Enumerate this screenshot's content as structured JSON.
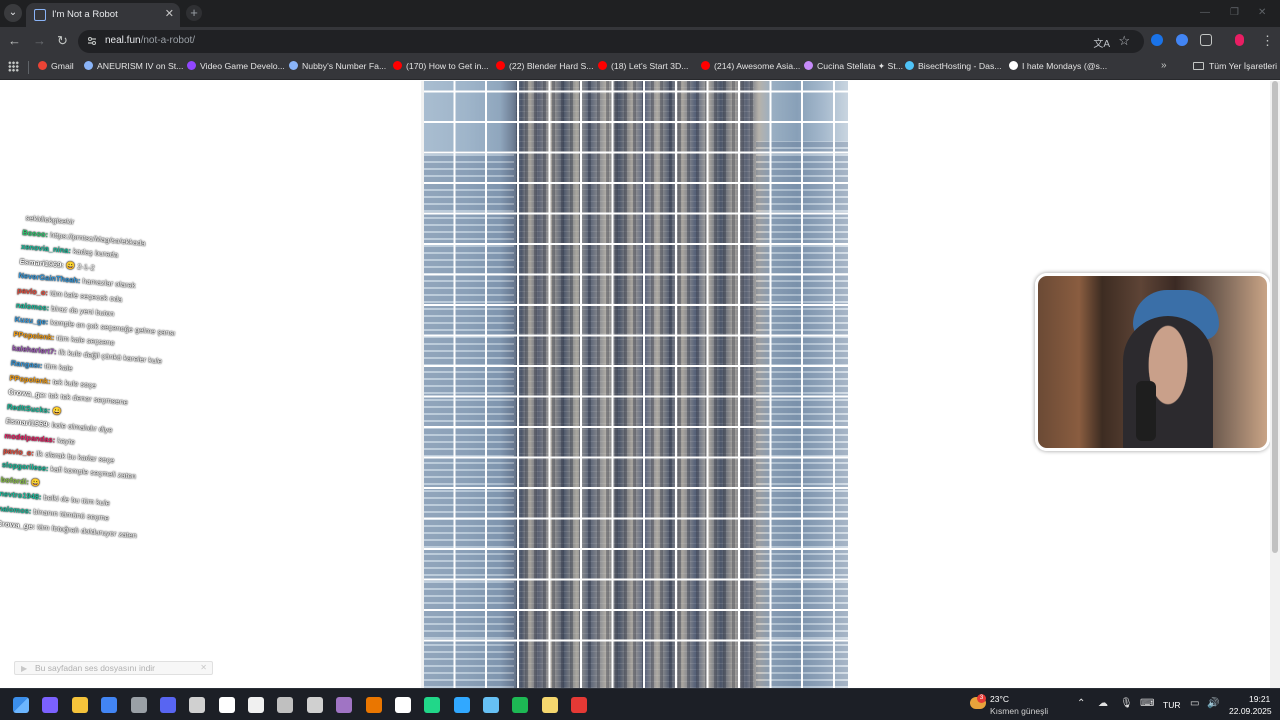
{
  "browser": {
    "tab_title": "I'm Not a Robot",
    "url_host": "neal.fun",
    "url_path": "/not-a-robot/",
    "all_bookmarks_label": "Tüm Yer İşaretleri"
  },
  "bookmarks": [
    {
      "label": "Gmail",
      "color": "#ea4335"
    },
    {
      "label": "ANEURISM IV on St...",
      "color": "#8ab4f8"
    },
    {
      "label": "Video Game Develo...",
      "color": "#9146ff"
    },
    {
      "label": "Nubby's Number Fa...",
      "color": "#8ab4f8"
    },
    {
      "label": "(170) How to Get in...",
      "color": "#ff0000"
    },
    {
      "label": "(22) Blender Hard S...",
      "color": "#ff0000"
    },
    {
      "label": "(18) Let's Start 3D...",
      "color": "#ff0000"
    },
    {
      "label": "(214) Awesome Asia...",
      "color": "#ff0000"
    },
    {
      "label": "Cucina Stellata ✦ St...",
      "color": "#c58af9"
    },
    {
      "label": "BisectHosting - Das...",
      "color": "#4fc3f7"
    },
    {
      "label": "I hate Mondays (@s...",
      "color": "#ffffff"
    }
  ],
  "chat": [
    {
      "user": "",
      "message": "sekidiekgisekir",
      "user_color": "#ffffff"
    },
    {
      "user": "Bosoo:",
      "message": "https://prntsc/Mag/sa/ekkada",
      "user_color": "#2ecc71"
    },
    {
      "user": "xenovia_nina:",
      "message": "kadaş burada",
      "user_color": "#1abc9c"
    },
    {
      "user": "Esmari1969:",
      "message": "😀 2-1-2",
      "user_color": "#ffffff"
    },
    {
      "user": "NeverGainTheah:",
      "message": "hamazlar olarak",
      "user_color": "#3498db"
    },
    {
      "user": "pavlo_o:",
      "message": "tüm kale seçecek oda",
      "user_color": "#e74c3c"
    },
    {
      "user": "nalomos:",
      "message": "biraz da yeni buton",
      "user_color": "#1abc9c"
    },
    {
      "user": "Kuzu_ge:",
      "message": "komple en çok seçeneğe gelme şansı",
      "user_color": "#3498db"
    },
    {
      "user": "PPopolenk:",
      "message": "tüm kale seçsene",
      "user_color": "#f39c12"
    },
    {
      "user": "kaleharlert7:",
      "message": "ilk kule değil çünkü kareler kule",
      "user_color": "#9b59b6"
    },
    {
      "user": "Rangası:",
      "message": "tüm kale",
      "user_color": "#3498db"
    },
    {
      "user": "PPopolenk:",
      "message": "tek kule seçe",
      "user_color": "#f39c12"
    },
    {
      "user": "Crowa_ge:",
      "message": "tek tek dener seçmsene",
      "user_color": "#ffffff"
    },
    {
      "user": "RedItSucks:",
      "message": "😀",
      "user_color": "#1abc9c"
    },
    {
      "user": "Esmari1969:",
      "message": "bole olmalıdır diye",
      "user_color": "#ffffff"
    },
    {
      "user": "modelpandas:",
      "message": "kayte",
      "user_color": "#e91e63"
    },
    {
      "user": "pavlo_o:",
      "message": "ilk olarak bu kadar seçe",
      "user_color": "#e74c3c"
    },
    {
      "user": "slopgorilese:",
      "message": "kafi komple seçmeli zaten",
      "user_color": "#1abc9c"
    },
    {
      "user": "bofordi:",
      "message": "😀",
      "user_color": "#8bc34a"
    },
    {
      "user": "nevtro1948:",
      "message": "belki de bu tüm kule",
      "user_color": "#1abc9c"
    },
    {
      "user": "nalomos:",
      "message": "binanın tümünü seçme",
      "user_color": "#1abc9c"
    },
    {
      "user": "Crowa_ge:",
      "message": "tüm fotoğrafı dolduruyor zaten",
      "user_color": "#ffffff"
    }
  ],
  "download_notice": "Bu sayfadan ses dosyasını indir",
  "taskbar": {
    "weather_temp": "23°C",
    "weather_desc": "Kısmen güneşli",
    "weather_badge": "3",
    "language": "TUR",
    "time": "19:21",
    "date": "22.09.2025"
  },
  "taskbar_apps": [
    {
      "name": "windows-start-icon",
      "color": "#3b8eea"
    },
    {
      "name": "copilot-icon",
      "color": "#7b61ff"
    },
    {
      "name": "file-explorer-icon",
      "color": "#f5c33b"
    },
    {
      "name": "chrome-icon",
      "color": "#4285f4"
    },
    {
      "name": "app-icon",
      "color": "#9aa0a6"
    },
    {
      "name": "discord-icon",
      "color": "#5865f2"
    },
    {
      "name": "obs-icon",
      "color": "#d0d0d0"
    },
    {
      "name": "unreal-icon",
      "color": "#ffffff"
    },
    {
      "name": "github-icon",
      "color": "#f0f0f0"
    },
    {
      "name": "settings-icon",
      "color": "#c0c0c0"
    },
    {
      "name": "unity-icon",
      "color": "#d0d0d0"
    },
    {
      "name": "visual-studio-icon",
      "color": "#a074c4"
    },
    {
      "name": "blender-icon",
      "color": "#ea7600"
    },
    {
      "name": "media-icon",
      "color": "#ffffff"
    },
    {
      "name": "pycharm-icon",
      "color": "#21d789"
    },
    {
      "name": "photoshop-icon",
      "color": "#31a8ff"
    },
    {
      "name": "steam-icon",
      "color": "#66c0f4"
    },
    {
      "name": "spotify-icon",
      "color": "#1db954"
    },
    {
      "name": "sticky-icon",
      "color": "#f5d76e"
    },
    {
      "name": "app-red-icon",
      "color": "#e53935"
    }
  ]
}
